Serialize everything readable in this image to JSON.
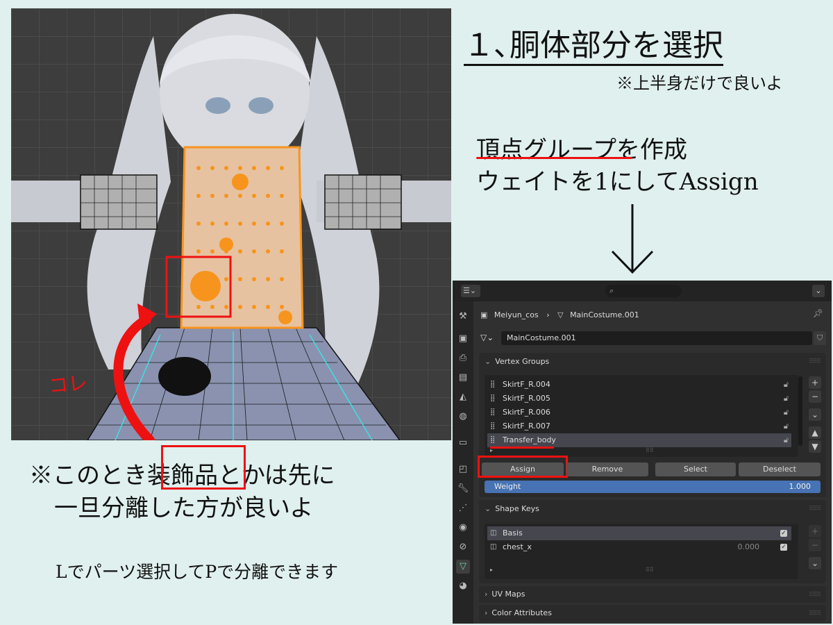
{
  "instructions": {
    "step_title": "１､胴体部分を選択",
    "step_note": "※上半身だけで良いよ",
    "line1": "頂点グループを作成",
    "line2": "ウェイトを1にしてAssign",
    "arrow": "↓",
    "note_left_1": "※このとき装飾品とかは先に",
    "note_left_2": "一旦分離した方が良いよ",
    "note_left_3": "Lでパーツ選択してPで分離できます",
    "kore_label": "コレ"
  },
  "colors": {
    "annotation_red": "#ee1111",
    "selection_orange": "#f7941d",
    "panel_bg": "#303030",
    "weight_blue": "#4772b3"
  },
  "panel": {
    "breadcrumb_object": "Meiyun_cos",
    "breadcrumb_sep": "›",
    "breadcrumb_mesh": "MainCostume.001",
    "mesh_name": "MainCostume.001",
    "vertex_groups": {
      "title": "Vertex Groups",
      "items": [
        {
          "name": "SkirtF_R.004"
        },
        {
          "name": "SkirtF_R.005"
        },
        {
          "name": "SkirtF_R.006"
        },
        {
          "name": "SkirtF_R.007"
        },
        {
          "name": "Transfer_body",
          "selected": true
        }
      ],
      "assign": "Assign",
      "remove": "Remove",
      "select": "Select",
      "deselect": "Deselect",
      "weight_label": "Weight",
      "weight_value": "1.000"
    },
    "shape_keys": {
      "title": "Shape Keys",
      "items": [
        {
          "name": "Basis",
          "selected": true,
          "value": ""
        },
        {
          "name": "chest_x",
          "selected": false,
          "value": "0.000"
        }
      ]
    },
    "uv_maps": "UV Maps",
    "color_attributes": "Color Attributes"
  }
}
